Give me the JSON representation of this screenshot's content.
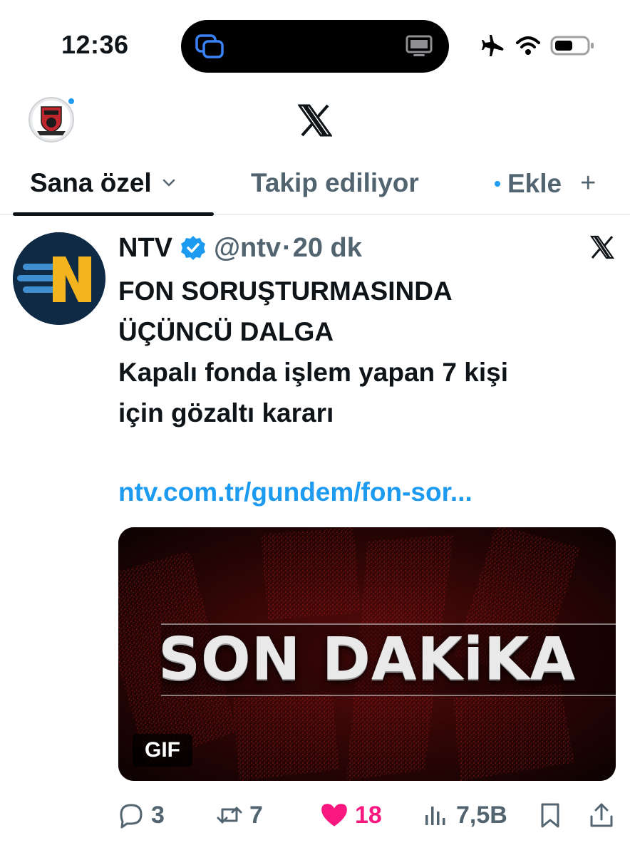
{
  "status_bar": {
    "time": "12:36"
  },
  "header": {
    "logo_icon": "x-logo-icon",
    "avatar_label": "TAKIMI"
  },
  "tabs": [
    {
      "label": "Sana özel",
      "active": true
    },
    {
      "label": "Takip ediliyor",
      "active": false
    },
    {
      "label": "Ekle",
      "active": false
    }
  ],
  "tweet": {
    "display_name": "NTV",
    "handle": "@ntv",
    "separator": "·",
    "time_ago": "20 dk",
    "text_lines": [
      "FON SORUŞTURMASINDA",
      "ÜÇÜNCÜ DALGA",
      "Kapalı fonda işlem yapan 7 kişi",
      "için gözaltı kararı"
    ],
    "link": "ntv.com.tr/gundem/fon-sor...",
    "media": {
      "headline": "SON DAKiKA",
      "badge": "GIF"
    },
    "actions": {
      "replies": "3",
      "retweets": "7",
      "likes": "18",
      "views": "7,5B"
    }
  },
  "colors": {
    "accent": "#1d9bf0",
    "like": "#f91880",
    "text_primary": "#0f1419",
    "text_secondary": "#536471"
  }
}
